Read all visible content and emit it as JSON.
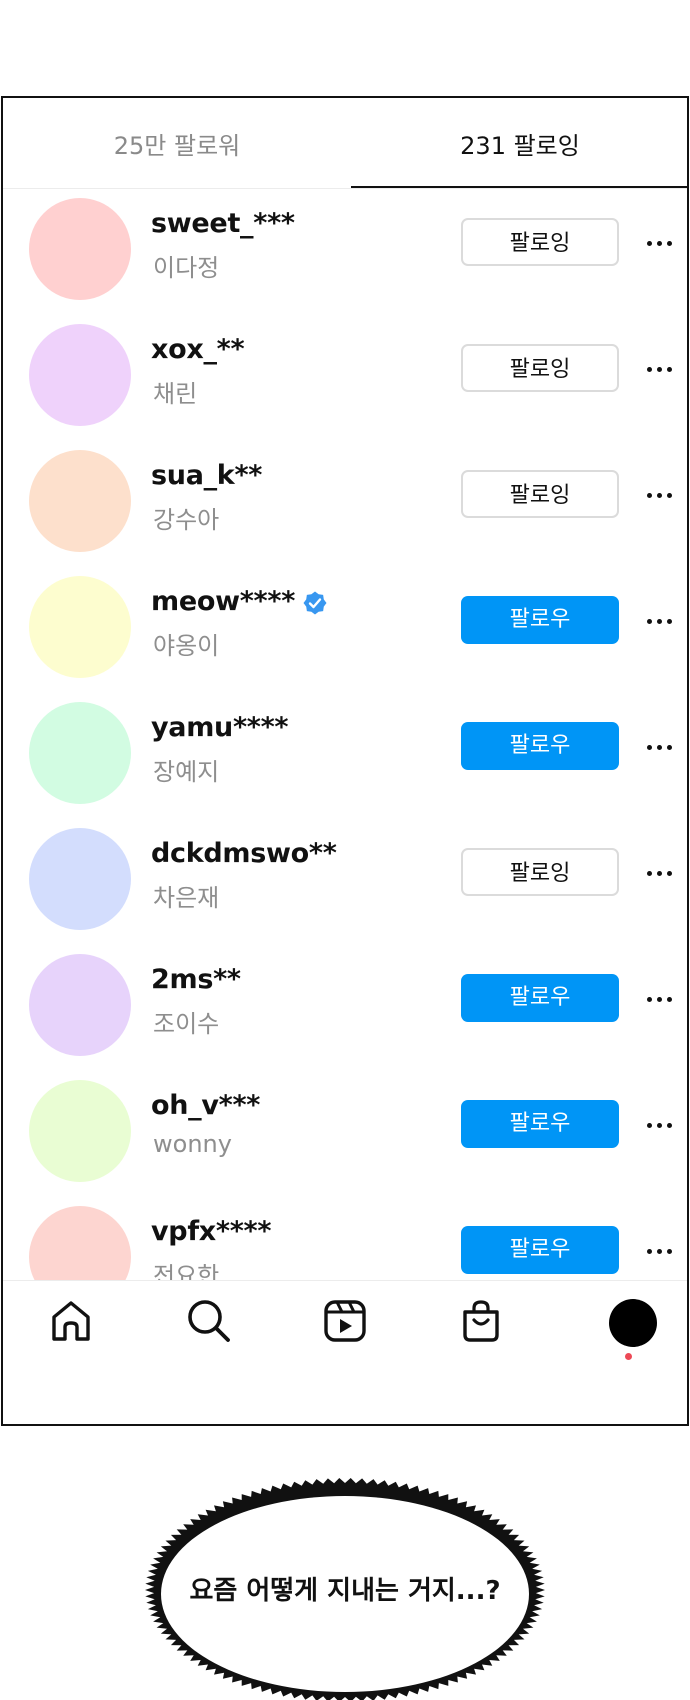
{
  "tabs": {
    "followers_label": "25만 팔로워",
    "following_label": "231 팔로잉"
  },
  "accounts": [
    {
      "username": "sweet_***",
      "name": "이다정",
      "button": "팔로잉",
      "state": "following",
      "avatar_color": "#ffd0d0",
      "verified": false
    },
    {
      "username": "xox_**",
      "name": "채린",
      "button": "팔로잉",
      "state": "following",
      "avatar_color": "#efd2fb",
      "verified": false
    },
    {
      "username": "sua_k**",
      "name": "강수아",
      "button": "팔로잉",
      "state": "following",
      "avatar_color": "#fde0cc",
      "verified": false
    },
    {
      "username": "meow****",
      "name": "야옹이",
      "button": "팔로우",
      "state": "follow",
      "avatar_color": "#fdfdcf",
      "verified": true
    },
    {
      "username": "yamu****",
      "name": "장예지",
      "button": "팔로우",
      "state": "follow",
      "avatar_color": "#d2fce2",
      "verified": false
    },
    {
      "username": "dckdmswo**",
      "name": "차은재",
      "button": "팔로잉",
      "state": "following",
      "avatar_color": "#d3ddfd",
      "verified": false
    },
    {
      "username": "2ms**",
      "name": "조이수",
      "button": "팔로우",
      "state": "follow",
      "avatar_color": "#e7d3fb",
      "verified": false
    },
    {
      "username": "oh_v***",
      "name": "wonny",
      "button": "팔로우",
      "state": "follow",
      "avatar_color": "#e9fdd3",
      "verified": false
    },
    {
      "username": "vpfx****",
      "name": "전요한",
      "button": "팔로우",
      "state": "follow",
      "avatar_color": "#fdd5d0",
      "verified": false
    }
  ],
  "colors": {
    "follow_button": "#0095f6",
    "verified_badge": "#3897f0",
    "notification_dot": "#ed4956"
  },
  "nav": {
    "icons": [
      "home-icon",
      "search-icon",
      "reels-icon",
      "shop-icon",
      "profile-avatar"
    ]
  },
  "caption": "요즘 어떻게 지내는 거지...?"
}
